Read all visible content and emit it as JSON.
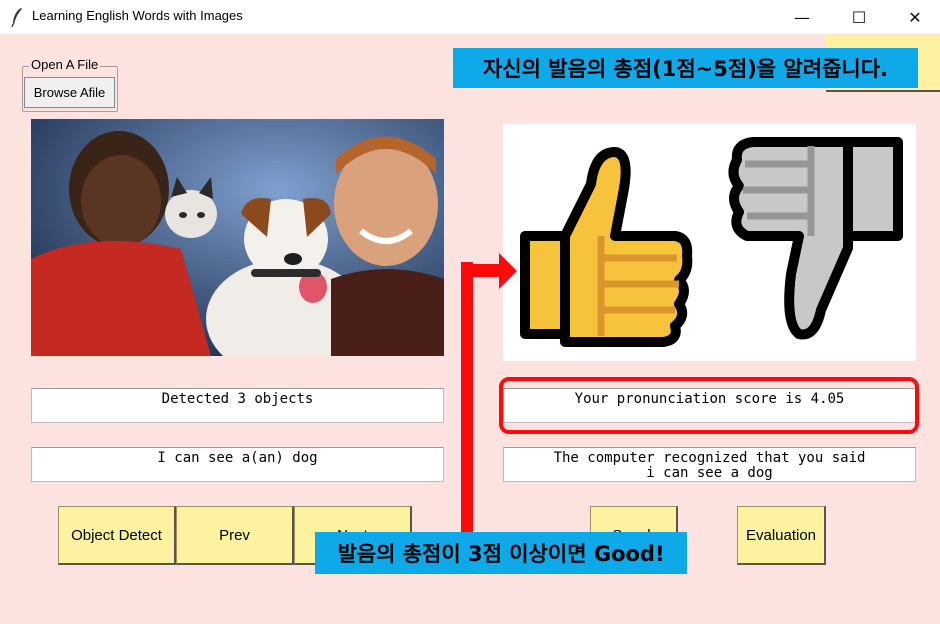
{
  "window": {
    "title": "Learning English Words with Images",
    "icon": "feather-icon",
    "controls": {
      "minimize": "—",
      "maximize": "☐",
      "close": "✕"
    }
  },
  "file_group": {
    "label": "Open A File",
    "browse_button": "Browse Afile"
  },
  "left_panel": {
    "detected_text": "Detected 3 objects",
    "caption_text": "I can see a(an) dog"
  },
  "right_panel": {
    "score_text": "Your pronunciation score is 4.05",
    "recognized_line1": "The computer recognized that you said",
    "recognized_line2": "i can see a dog"
  },
  "buttons": {
    "object_detect": "Object Detect",
    "prev": "Prev",
    "next": "Next",
    "speak": "Speak",
    "evaluation": "Evaluation"
  },
  "annotations": {
    "top_callout": "자신의 발음의 총점(1점~5점)을 알려줍니다.",
    "bottom_callout": "발음의 총점이 3점 이상이면 Good!"
  },
  "colors": {
    "background": "#fde3df",
    "button": "#fdf2a0",
    "callout": "#0fa8e9",
    "highlight": "#ff0a0a",
    "thumbs_up": "#f7c23c",
    "thumbs_down": "#c8c8c8"
  }
}
